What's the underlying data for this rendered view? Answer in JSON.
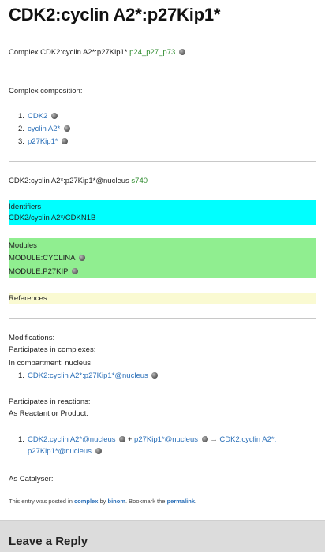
{
  "title": "CDK2:cyclin A2*:p27Kip1*",
  "complex_line": {
    "prefix": "Complex CDK2:cyclin A2*:p27Kip1*",
    "ids": "p24_p27_p73"
  },
  "composition": {
    "heading": "Complex composition:",
    "items": [
      {
        "num": "1.",
        "label": "CDK2"
      },
      {
        "num": "2.",
        "label": "cyclin A2*"
      },
      {
        "num": "3.",
        "label": "p27Kip1*"
      }
    ]
  },
  "species_line": {
    "text": "CDK2:cyclin A2*:p27Kip1*@nucleus",
    "id": "s740"
  },
  "identifiers": {
    "heading": "Identifiers",
    "value": "CDK2/cyclin A2*/CDKN1B"
  },
  "modules": {
    "heading": "Modules",
    "items": [
      "MODULE:CYCLINA",
      "MODULE:P27KIP"
    ]
  },
  "references": {
    "heading": "References"
  },
  "details": {
    "modifications": "Modifications:",
    "participates_complexes": "Participates in complexes:",
    "compartment": "In compartment: nucleus",
    "complex_item": {
      "num": "1.",
      "label": "CDK2:cyclin A2*:p27Kip1*@nucleus"
    },
    "participates_reactions": "Participates in reactions:",
    "as_reactant": "As Reactant or Product:",
    "reaction": {
      "num": "1.",
      "reactant1": "CDK2:cyclin A2*@nucleus",
      "plus": "+",
      "reactant2": "p27Kip1*@nucleus",
      "arrow": "→",
      "product_part1": "CDK2:cyclin A2*:",
      "product_part2": "p27Kip1*@nucleus"
    },
    "as_catalyser": "As Catalyser:"
  },
  "posted": {
    "pre": "This entry was posted in",
    "category": "complex",
    "by": "by",
    "author": "binom",
    "bookmark": ". Bookmark the",
    "permalink": "permalink",
    "end": "."
  },
  "footer": {
    "heading": "Leave a Reply"
  }
}
